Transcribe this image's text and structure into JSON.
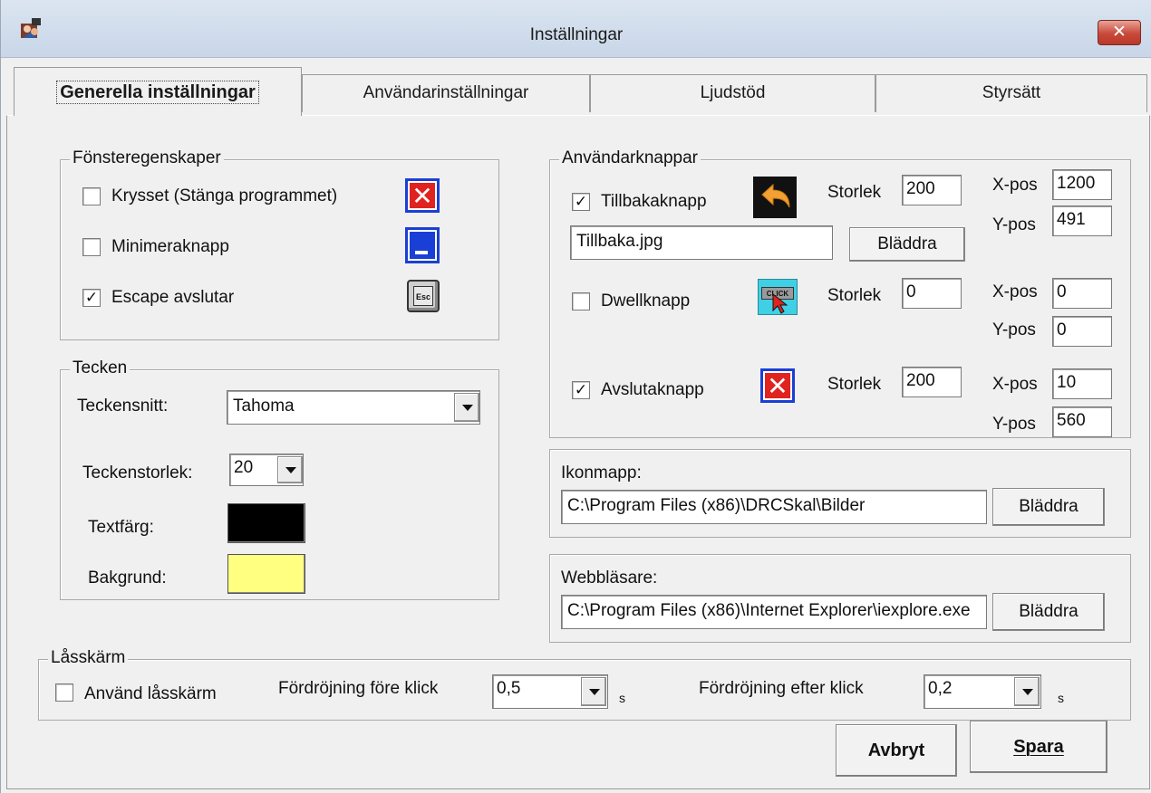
{
  "window": {
    "title": "Inställningar",
    "close_label": "✕"
  },
  "tabs": [
    {
      "label": "Generella inställningar",
      "active": true
    },
    {
      "label": "Användarinställningar",
      "active": false
    },
    {
      "label": "Ljudstöd",
      "active": false
    },
    {
      "label": "Styrsätt",
      "active": false
    }
  ],
  "window_props": {
    "title": "Fönsteregenskaper",
    "items": [
      {
        "label": "Krysset (Stänga programmet)",
        "checked": false,
        "icon": "close-x-icon"
      },
      {
        "label": "Minimeraknapp",
        "checked": false,
        "icon": "minimize-icon"
      },
      {
        "label": "Escape avslutar",
        "checked": true,
        "icon": "esc-key-icon"
      }
    ],
    "esc_icon_text": "Esc"
  },
  "font": {
    "title": "Tecken",
    "family_label": "Teckensnitt:",
    "family_value": "Tahoma",
    "size_label": "Teckenstorlek:",
    "size_value": "20",
    "text_color_label": "Textfärg:",
    "text_color": "#000000",
    "background_label": "Bakgrund:",
    "background_color": "#ffff80"
  },
  "user_buttons": {
    "title": "Användarknappar",
    "size_label": "Storlek",
    "x_label": "X-pos",
    "y_label": "Y-pos",
    "browse_label": "Bläddra",
    "back": {
      "label": "Tillbakaknapp",
      "checked": true,
      "size": "200",
      "x": "1200",
      "y": "491",
      "file": "Tillbaka.jpg"
    },
    "dwell": {
      "label": "Dwellknapp",
      "checked": false,
      "size": "0",
      "x": "0",
      "y": "0",
      "icon_text": "CLICK"
    },
    "exit": {
      "label": "Avslutaknapp",
      "checked": true,
      "size": "200",
      "x": "10",
      "y": "560"
    }
  },
  "icon_folder": {
    "label": "Ikonmapp:",
    "path": "C:\\Program Files (x86)\\DRCSkal\\Bilder",
    "browse_label": "Bläddra"
  },
  "browser": {
    "label": "Webbläsare:",
    "path": "C:\\Program Files (x86)\\Internet Explorer\\iexplore.exe",
    "browse_label": "Bläddra"
  },
  "lock_screen": {
    "title": "Låsskärm",
    "use_label": "Använd låsskärm",
    "use_checked": false,
    "before_label": "Fördröjning före klick",
    "before_value": "0,5",
    "after_label": "Fördröjning efter klick",
    "after_value": "0,2",
    "unit": "s"
  },
  "footer": {
    "cancel_label": "Avbryt",
    "save_label": "Spara"
  },
  "colors": {
    "title_close": "#c8493a",
    "icon_blue": "#1a3fd6",
    "icon_red": "#e0231f",
    "back_arrow": "#f2a033"
  }
}
